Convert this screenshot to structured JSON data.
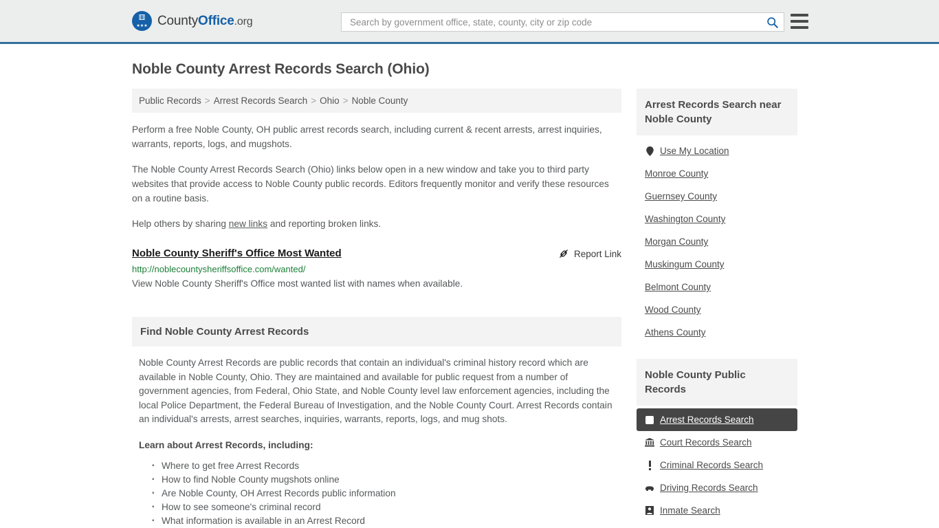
{
  "header": {
    "logo": {
      "name_part1": "County",
      "name_part2": "Office",
      "suffix": ".org",
      "emblem_icon": "eagle-seal-icon",
      "emblem_color": "#1560a8"
    },
    "search": {
      "placeholder": "Search by government office, state, county, city or zip code",
      "value": "",
      "icon": "search-icon"
    },
    "menu_icon": "hamburger-menu-icon",
    "accent_color": "#35709c"
  },
  "page": {
    "title": "Noble County Arrest Records Search (Ohio)"
  },
  "breadcrumb": {
    "separator": ">",
    "items": [
      {
        "label": "Public Records",
        "current": false
      },
      {
        "label": "Arrest Records Search",
        "current": false
      },
      {
        "label": "Ohio",
        "current": false
      },
      {
        "label": "Noble County",
        "current": true
      }
    ]
  },
  "intro": {
    "paragraph_1": "Perform a free Noble County, OH public arrest records search, including current & recent arrests, arrest inquiries, warrants, reports, logs, and mugshots.",
    "paragraph_2": "The Noble County Arrest Records Search (Ohio) links below open in a new window and take you to third party websites that provide access to Noble County public records. Editors frequently monitor and verify these resources on a routine basis.",
    "paragraph_3_before": "Help others by sharing ",
    "paragraph_3_link": "new links",
    "paragraph_3_after": " and reporting broken links."
  },
  "result": {
    "title": "Noble County Sheriff's Office Most Wanted",
    "url": "http://noblecountysheriffsoffice.com/wanted/",
    "description": "View Noble County Sheriff's Office most wanted list with names when available.",
    "report_label": "Report Link",
    "report_icon": "unlink-icon",
    "url_color": "#1a7f37"
  },
  "panel": {
    "heading": "Find Noble County Arrest Records",
    "body": "Noble County Arrest Records are public records that contain an individual's criminal history record which are available in Noble County, Ohio. They are maintained and available for public request from a number of government agencies, from Federal, Ohio State, and Noble County level law enforcement agencies, including the local Police Department, the Federal Bureau of Investigation, and the Noble County Court. Arrest Records contain an individual's arrests, arrest searches, inquiries, warrants, reports, logs, and mug shots.",
    "learn_heading": "Learn about Arrest Records, including:",
    "bullets": [
      "Where to get free Arrest Records",
      "How to find Noble County mugshots online",
      "Are Noble County, OH Arrest Records public information",
      "How to see someone's criminal record",
      "What information is available in an Arrest Record"
    ]
  },
  "sidebar": {
    "nearby": {
      "heading": "Arrest Records Search near Noble County",
      "use_my_location": {
        "label": "Use My Location",
        "icon": "map-pin-icon"
      },
      "counties": [
        "Monroe County",
        "Guernsey County",
        "Washington County",
        "Morgan County",
        "Muskingum County",
        "Belmont County",
        "Wood County",
        "Athens County"
      ]
    },
    "public_records": {
      "heading": "Noble County Public Records",
      "items": [
        {
          "label": "Arrest Records Search",
          "icon": "fingerprint-card-icon",
          "active": true
        },
        {
          "label": "Court Records Search",
          "icon": "courthouse-icon",
          "active": false
        },
        {
          "label": "Criminal Records Search",
          "icon": "exclamation-icon",
          "active": false
        },
        {
          "label": "Driving Records Search",
          "icon": "car-icon",
          "active": false
        },
        {
          "label": "Inmate Search",
          "icon": "inmate-icon",
          "active": false
        }
      ],
      "active_bg": "#454545"
    }
  }
}
